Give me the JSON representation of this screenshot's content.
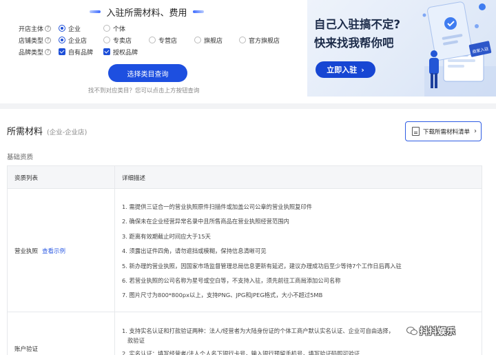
{
  "heading": "入驻所需材料、费用",
  "filters": {
    "subject": {
      "label": "开店主体",
      "options": [
        "企业",
        "个体"
      ],
      "selected": "企业"
    },
    "store_type": {
      "label": "店铺类型",
      "options": [
        "企业店",
        "专卖店",
        "专营店",
        "旗舰店",
        "官方旗舰店"
      ],
      "selected": "企业店"
    },
    "brand_type": {
      "label": "品牌类型",
      "options": [
        "自有品牌",
        "授权品牌"
      ],
      "checked": [
        "自有品牌",
        "授权品牌"
      ]
    }
  },
  "query_button": "选择类目查询",
  "hint": "找不到对应类目？您可以点击上方按钮查询",
  "banner": {
    "line1": "自己入驻搞不定?",
    "line2": "快来找我帮你吧",
    "cta": "立即入驻",
    "sign": "商家入驻"
  },
  "materials": {
    "title": "所需材料",
    "subtitle": "(企业-企业店)",
    "download_button": "下载所需材料清单",
    "section": "基础资质",
    "columns": [
      "资质列表",
      "详细描述"
    ],
    "rows": [
      {
        "name": "营业执照",
        "link": "查看示例",
        "items": [
          "1. 需提供三证合一的营业执照原件扫描件或加盖公司公章的营业执照复印件",
          "2. 确保未在企业经营异常名录中且所售商品在营业执照经营范围内",
          "3. 距离有效期截止时间应大于15天",
          "4. 须露出证件四角，请勿遮挡或模糊，保持信息清晰可见",
          "5. 新办理的营业执照，因国家市场监督管理总局信息更新有延迟，建议办理成功后至少等待7个工作日后再入驻",
          "6. 若营业执照的公司名称为星号或空白等，不支持入驻，须先前往工商局添加公司名称",
          "7. 图片尺寸为800*800px以上，支持PNG、JPG和JPEG格式，大小不超过5MB"
        ]
      },
      {
        "name": "账户验证",
        "link": "",
        "items": [
          "1. 支持实名认证和打款验证两种：法人/经营者为大陆身份证的个体工商户默认实名认证、企业可自由选择，",
          "   款验证",
          "2. 实名认证：填写经营者/法人个人名下银行卡号，输入银行预留手机号，填写验证码即可验证"
        ]
      }
    ]
  },
  "watermark": "抖抖娱乐"
}
